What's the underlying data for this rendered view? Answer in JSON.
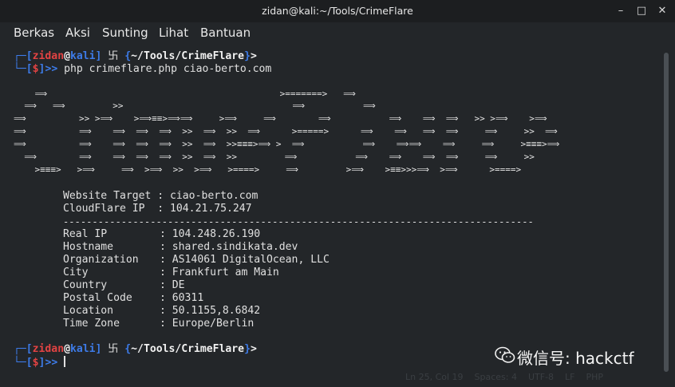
{
  "window": {
    "title": "zidan@kali:~/Tools/CrimeFlare",
    "minimize": "–",
    "maximize": "□",
    "close": "✕"
  },
  "menu": [
    "Berkas",
    "Aksi",
    "Sunting",
    "Lihat",
    "Bantuan"
  ],
  "prompt": {
    "user": "zidan",
    "at": "@",
    "host": "kali",
    "symbol": "卐",
    "path": "~/Tools/CrimeFlare",
    "dollar": "$",
    "arrows": ">>"
  },
  "command": "php crimeflare.php ciao-berto.com",
  "ascii_art": [
    "    ⟹                                            >=======>   ⟹",
    "  ⟹   ⟹         >>                                ⟹           ⟹",
    "⟹          >> >⟹    >⟹≡≡>⟹⟹     >⟹     ⟹        ⟹           ⟹    ⟹  ⟹   >> >⟹    >⟹",
    "⟹          ⟹    ⟹  ⟹  ⟹  >>  ⟹  >>  ⟹      >=====>      ⟹    ⟹   ⟹  ⟹     ⟹     >>  ⟹",
    "⟹          ⟹    ⟹  ⟹  ⟹  >>  ⟹  >>≡≡≡>⟹ >  ⟹           ⟹    ⟹⟹    ⟹     ⟹     >≡≡≡>⟹",
    "  ⟹        ⟹    ⟹  ⟹  ⟹  >>  ⟹  >>         ⟹           ⟹    ⟹    ⟹  ⟹     ⟹     >>",
    "    >≡≡≡>   >⟹     ⟹  >⟹  >>  >⟹   >====>     ⟹         >⟹    >≡≡>>>⟹  >⟹      >====>"
  ],
  "info": {
    "website_target_label": "Website Target",
    "website_target": "ciao-berto.com",
    "cloudflare_ip_label": "CloudFlare IP",
    "cloudflare_ip": "104.21.75.247",
    "separator": "---------------------------------------------------------------------------------",
    "rows": [
      {
        "label": "Real IP",
        "value": "104.248.26.190"
      },
      {
        "label": "Hostname",
        "value": "shared.sindikata.dev"
      },
      {
        "label": "Organization",
        "value": "AS14061 DigitalOcean, LLC"
      },
      {
        "label": "City",
        "value": "Frankfurt am Main"
      },
      {
        "label": "Country",
        "value": "DE"
      },
      {
        "label": "Postal Code",
        "value": "60311"
      },
      {
        "label": "Location",
        "value": "50.1155,8.6842"
      },
      {
        "label": "Time Zone",
        "value": "Europe/Berlin"
      }
    ]
  },
  "watermark": "微信号: hackctf",
  "status_bar": "Ln 25, Col 19    Spaces: 4    UTF-8    LF    PHP"
}
